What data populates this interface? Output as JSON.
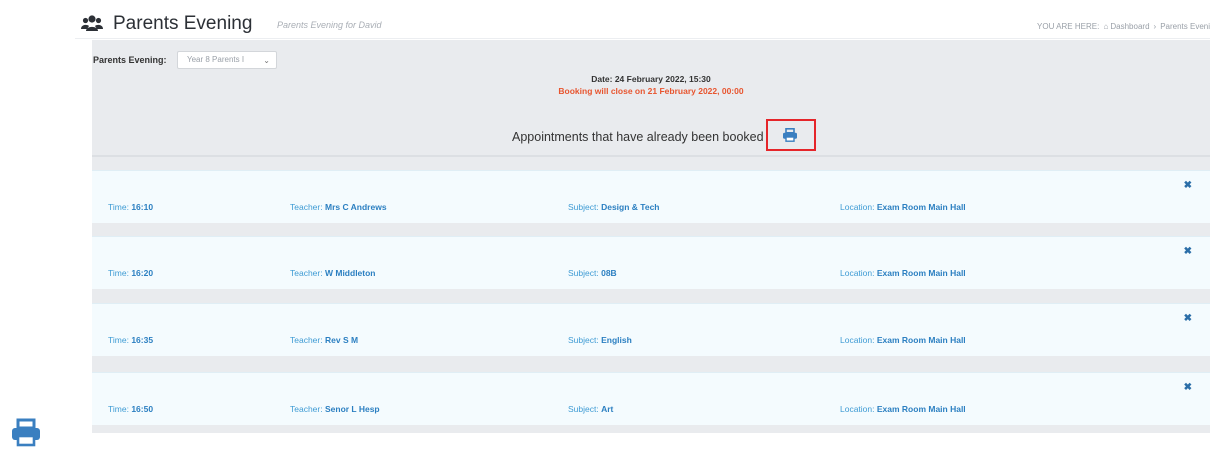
{
  "header": {
    "title": "Parents Evening",
    "subtitle": "Parents Evening for David",
    "breadcrumb_prefix": "YOU ARE HERE:",
    "breadcrumb_home": "Dashboard",
    "breadcrumb_sep": "›",
    "breadcrumb_current": "Parents Eveni"
  },
  "selector": {
    "label": "Parents Evening:",
    "value": "Year 8 Parents I"
  },
  "info": {
    "date": "Date: 24 February 2022, 15:30",
    "closing": "Booking will close on 21 February 2022, 00:00"
  },
  "booked_heading": "Appointments that have already been booked",
  "field_labels": {
    "time": "Time:",
    "teacher": "Teacher:",
    "subject": "Subject:",
    "location": "Location:"
  },
  "appointments": [
    {
      "time": "16:10",
      "teacher": "Mrs C Andrews",
      "subject": "Design & Tech",
      "location": "Exam Room Main Hall"
    },
    {
      "time": "16:20",
      "teacher": "W Middleton",
      "subject": "08B",
      "location": "Exam Room Main Hall"
    },
    {
      "time": "16:35",
      "teacher": "Rev S M",
      "subject": "English",
      "location": "Exam Room Main Hall"
    },
    {
      "time": "16:50",
      "teacher": "Senor L Hesp",
      "subject": "Art",
      "location": "Exam Room Main Hall"
    }
  ],
  "colors": {
    "accent_link": "#3e9bd4",
    "accent_bold": "#2b7fc1",
    "closing_text": "#e8552f",
    "highlight_box": "#e5252a",
    "icon_blue": "#3a7fc0"
  },
  "icons": {
    "header": "users-icon",
    "breadcrumb": "home-icon",
    "print": "print-icon",
    "remove": "close-icon"
  }
}
